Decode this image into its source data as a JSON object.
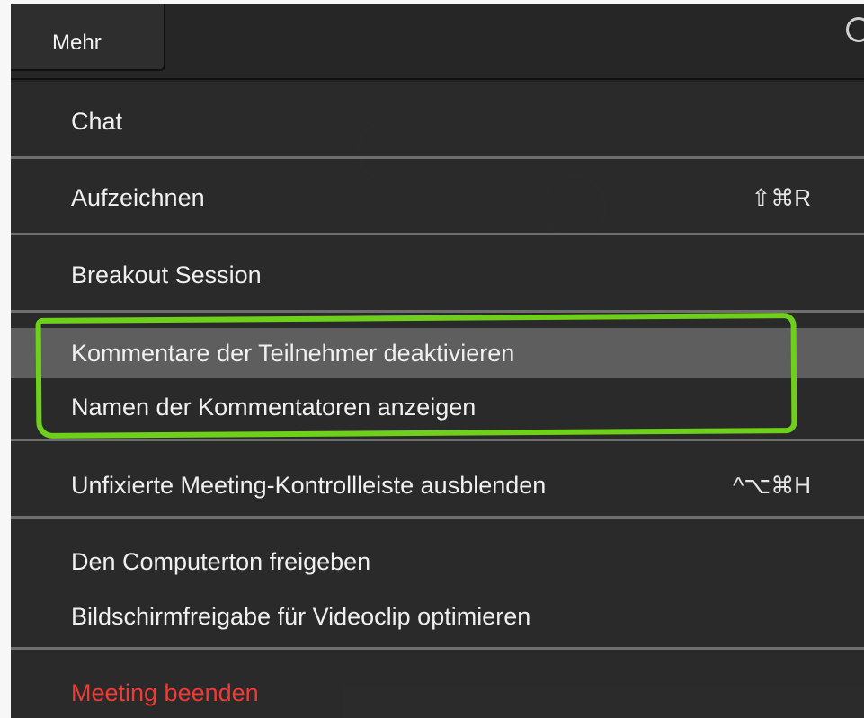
{
  "toolbar": {
    "more_tab_label": "Mehr"
  },
  "menu": {
    "items": [
      {
        "label": "Chat"
      },
      {
        "label": "Aufzeichnen",
        "shortcut": "⇧⌘R"
      },
      {
        "label": "Breakout Session"
      },
      {
        "label": "Kommentare der Teilnehmer deaktivieren",
        "highlighted": true
      },
      {
        "label": "Namen der Kommentatoren anzeigen"
      },
      {
        "label": "Unfixierte Meeting-Kontrollleiste ausblenden",
        "shortcut": "^⌥⌘H"
      },
      {
        "label": "Den Computerton freigeben"
      },
      {
        "label": "Bildschirmfreigabe für Videoclip optimieren"
      },
      {
        "label": "Meeting beenden",
        "danger": true
      }
    ]
  },
  "colors": {
    "menu_bg": "#2b2b2b",
    "highlight": "#5e5e5e",
    "danger": "#ef3b34",
    "annotation": "#6fd01c"
  }
}
